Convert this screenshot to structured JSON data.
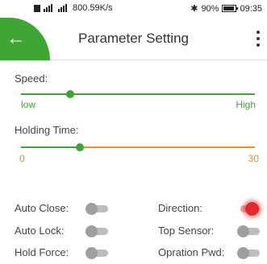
{
  "status_bar": {
    "network_speed": "800.59K/s",
    "battery": "90%",
    "time": "09:35"
  },
  "app_bar": {
    "title": "Parameter Setting"
  },
  "speed": {
    "label": "Speed:",
    "min_label": "low",
    "max_label": "High",
    "value_fraction": 0.21
  },
  "holding_time": {
    "label": "Holding Time:",
    "min_label": "0",
    "max_label": "30",
    "value_fraction": 0.25
  },
  "toggles": [
    {
      "label": "Auto Close:",
      "on": false
    },
    {
      "label": "Direction:",
      "on": true
    },
    {
      "label": "Auto Lock:",
      "on": false
    },
    {
      "label": "Top Sensor:",
      "on": false
    },
    {
      "label": "Hold Force:",
      "on": false
    },
    {
      "label": "Opration Pwd:",
      "on": false
    }
  ],
  "colors": {
    "accent_green": "#3fa535",
    "orange": "#f08c2b",
    "toggle_on": "#e8262b"
  }
}
